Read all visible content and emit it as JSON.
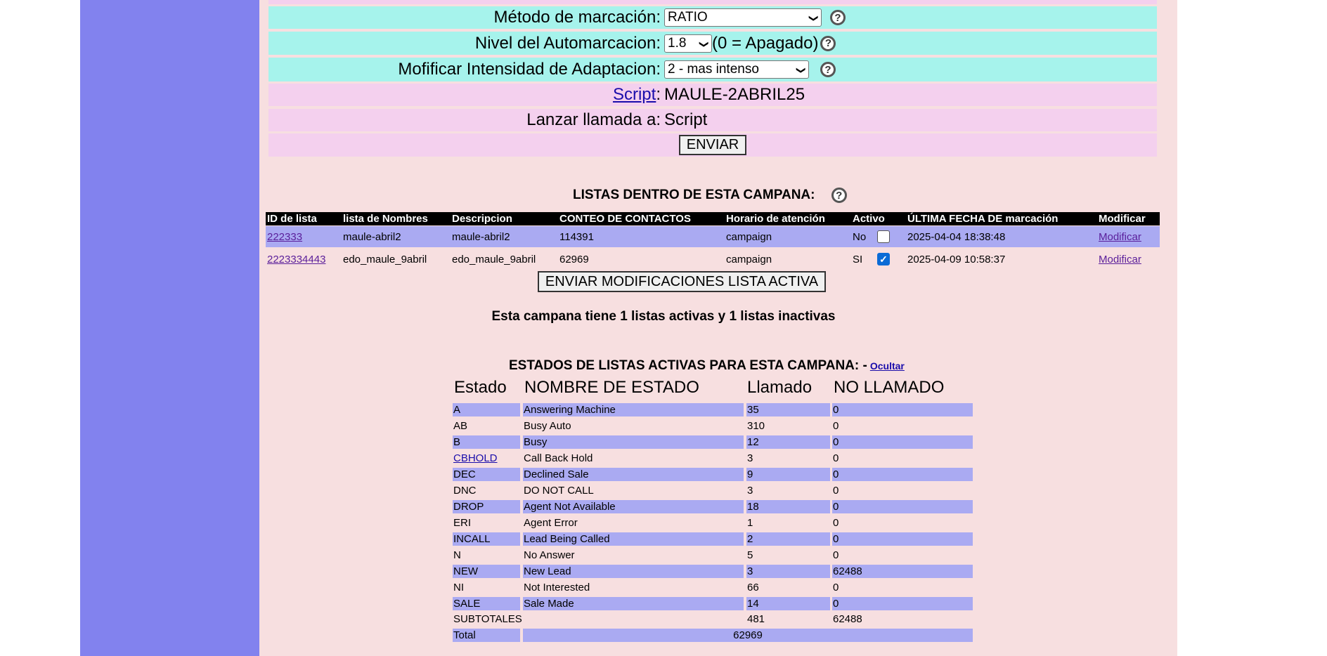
{
  "form": {
    "dial_method": {
      "label": "Método de marcación:",
      "value": "RATIO"
    },
    "auto_dial_level": {
      "label": "Nivel del Automarcacion:",
      "value": "1.8",
      "note": "(0 = Apagado)"
    },
    "adapt_intensity": {
      "label": "Mofificar Intensidad de Adaptacion:",
      "value": "2 - mas intenso"
    },
    "script": {
      "link": "Script",
      "suffix": ":",
      "value": "MAULE-2ABRIL25"
    },
    "launch_call": {
      "label": "Lanzar llamada a:",
      "value": "Script"
    },
    "submit_label": "ENVIAR",
    "help_glyph": "?"
  },
  "lists": {
    "heading": "LISTAS DENTRO DE ESTA CAMPANA:",
    "columns": [
      "ID de lista",
      "lista de Nombres",
      "Descripcion",
      "CONTEO DE CONTACTOS",
      "Horario de atención",
      "Activo",
      "ÚLTIMA FECHA DE marcación",
      "Modificar"
    ],
    "rows": [
      {
        "id": "222333",
        "name": "maule-abril2",
        "description": "maule-abril2",
        "count": "114391",
        "schedule": "campaign",
        "active": "No",
        "checked": false,
        "last_dial": "2025-04-04 18:38:48",
        "modify": "Modificar"
      },
      {
        "id": "2223334443",
        "name": "edo_maule_9abril",
        "description": "edo_maule_9abril",
        "count": "62969",
        "schedule": "campaign",
        "active": "SI",
        "checked": true,
        "last_dial": "2025-04-09 10:58:37",
        "modify": "Modificar"
      }
    ],
    "submit_label": "ENVIAR MODIFICACIONES LISTA ACTIVA",
    "summary": "Esta campana tiene 1 listas activas y 1 listas inactivas"
  },
  "statuses": {
    "heading": "ESTADOS DE LISTAS ACTIVAS PARA ESTA CAMPANA: -",
    "hide_link": "Ocultar",
    "columns": [
      "Estado",
      "NOMBRE DE ESTADO",
      "Llamado",
      "NO LLAMADO"
    ],
    "rows": [
      {
        "code": "A",
        "name": "Answering Machine",
        "called": "35",
        "not_called": "0"
      },
      {
        "code": "AB",
        "name": "Busy Auto",
        "called": "310",
        "not_called": "0"
      },
      {
        "code": "B",
        "name": "Busy",
        "called": "12",
        "not_called": "0"
      },
      {
        "code": "CBHOLD",
        "name": "Call Back Hold",
        "called": "3",
        "not_called": "0"
      },
      {
        "code": "DEC",
        "name": "Declined Sale",
        "called": "9",
        "not_called": "0"
      },
      {
        "code": "DNC",
        "name": "DO NOT CALL",
        "called": "3",
        "not_called": "0"
      },
      {
        "code": "DROP",
        "name": "Agent Not Available",
        "called": "18",
        "not_called": "0"
      },
      {
        "code": "ERI",
        "name": "Agent Error",
        "called": "1",
        "not_called": "0"
      },
      {
        "code": "INCALL",
        "name": "Lead Being Called",
        "called": "2",
        "not_called": "0"
      },
      {
        "code": "N",
        "name": "No Answer",
        "called": "5",
        "not_called": "0"
      },
      {
        "code": "NEW",
        "name": "New Lead",
        "called": "3",
        "not_called": "62488"
      },
      {
        "code": "NI",
        "name": "Not Interested",
        "called": "66",
        "not_called": "0"
      },
      {
        "code": "SALE",
        "name": "Sale Made",
        "called": "14",
        "not_called": "0"
      }
    ],
    "subtotal": {
      "label": "SUBTOTALES",
      "called": "481",
      "not_called": "62488"
    },
    "total": {
      "label": "Total",
      "value": "62969"
    }
  }
}
